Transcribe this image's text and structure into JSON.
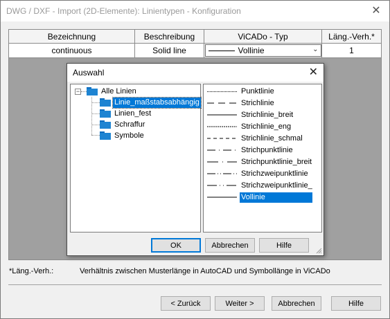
{
  "window": {
    "title": "DWG / DXF - Import (2D-Elemente): Linientypen - Konfiguration"
  },
  "table": {
    "headers": [
      "Bezeichnung",
      "Beschreibung",
      "ViCADo - Typ",
      "Läng.-Verh.*"
    ],
    "row": {
      "bezeichnung": "continuous",
      "beschreibung": "Solid line",
      "typ": "Vollinie",
      "verh": "1"
    }
  },
  "footnote": {
    "key": "*Läng.-Verh.:",
    "text": "Verhältnis zwischen Musterlänge in AutoCAD  und Symbollänge in ViCADo"
  },
  "buttons": {
    "back": "< Zurück",
    "next": "Weiter >",
    "cancel": "Abbrechen",
    "help": "Hilfe"
  },
  "dialog": {
    "title": "Auswahl",
    "tree": {
      "root": "Alle Linien",
      "children": [
        "Linie_maßstabsabhängig",
        "Linien_fest",
        "Schraffur",
        "Symbole"
      ],
      "selected_index": 0
    },
    "linetypes": [
      "Punktlinie",
      "Strichlinie",
      "Strichlinie_breit",
      "Strichlinie_eng",
      "Strichlinie_schmal",
      "Strichpunktlinie",
      "Strichpunktlinie_breit",
      "Strichzweipunktlinie",
      "Strichzweipunktlinie_b",
      "Vollinie"
    ],
    "selected_linetype": "Vollinie",
    "buttons": {
      "ok": "OK",
      "cancel": "Abbrechen",
      "help": "Hilfe"
    }
  },
  "colors": {
    "selection": "#0078d7",
    "folder": "#1e84d2",
    "gray_area": "#a0a0a0"
  }
}
